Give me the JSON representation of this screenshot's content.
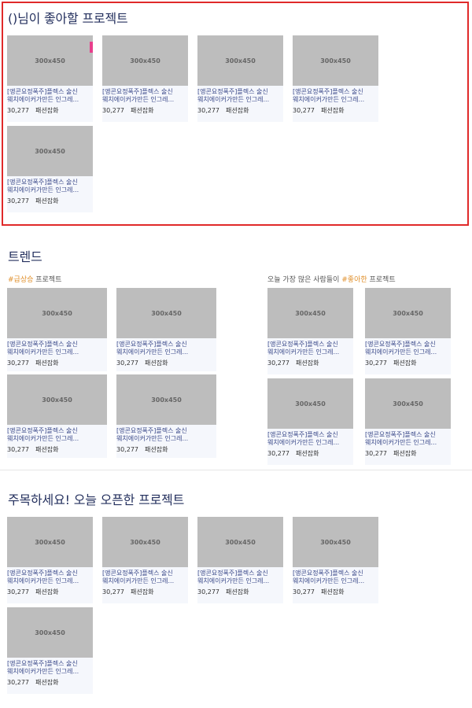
{
  "likes_section": {
    "title": "()님이 좋아할 프로젝트",
    "cards": [
      {
        "thumb": "300x450",
        "line1": "[앵콘요정폭주]플렉스 술신",
        "line2": "웨치에이커가만든 인그레...",
        "count": "30,277",
        "category": "패션잡화"
      },
      {
        "thumb": "300x450",
        "line1": "[앵콘요정폭주]플렉스 술신",
        "line2": "웨치에이커가만든 인그레...",
        "count": "30,277",
        "category": "패션잡화"
      },
      {
        "thumb": "300x450",
        "line1": "[앵콘요정폭주]플렉스 술신",
        "line2": "웨치에이커가만든 인그레...",
        "count": "30,277",
        "category": "패션잡화"
      },
      {
        "thumb": "300x450",
        "line1": "[앵콘요정폭주]플렉스 술신",
        "line2": "웨치에이커가만든 인그레...",
        "count": "30,277",
        "category": "패션잡화"
      },
      {
        "thumb": "300x450",
        "line1": "[앵콘요정폭주]플렉스 술신",
        "line2": "웨치에이커가만든 인그레...",
        "count": "30,277",
        "category": "패션잡화"
      }
    ]
  },
  "trend_section": {
    "title": "트렌드",
    "rising": {
      "prefix": "#급상승",
      "suffix": " 프로젝트",
      "cards": [
        {
          "thumb": "300x450",
          "line1": "[앵콘요정폭주]플렉스 술신",
          "line2": "웨치에이커가만든 인그레...",
          "count": "30,277",
          "category": "패션잡화"
        },
        {
          "thumb": "300x450",
          "line1": "[앵콘요정폭주]플렉스 술신",
          "line2": "웨치에이커가만든 인그레...",
          "count": "30,277",
          "category": "패션잡화"
        },
        {
          "thumb": "300x450",
          "line1": "[앵콘요정폭주]플렉스 술신",
          "line2": "웨치에이커가만든 인그레...",
          "count": "30,277",
          "category": "패션잡화"
        },
        {
          "thumb": "300x450",
          "line1": "[앵콘요정폭주]플렉스 술신",
          "line2": "웨치에이커가만든 인그레...",
          "count": "30,277",
          "category": "패션잡화"
        }
      ]
    },
    "liked": {
      "prefix": "오늘 가장 많은 사람들이 ",
      "highlight": "#좋아한",
      "suffix": " 프로젝트",
      "cards": [
        {
          "thumb": "300x450",
          "line1": "[앵콘요정폭주]플렉스 술신",
          "line2": "웨치에이커가만든 인그레...",
          "count": "30,277",
          "category": "패션잡화"
        },
        {
          "thumb": "300x450",
          "line1": "[앵콘요정폭주]플렉스 술신",
          "line2": "웨치에이커가만든 인그레...",
          "count": "30,277",
          "category": "패션잡화"
        },
        {
          "thumb": "300x450",
          "line1": "[앵콘요정폭주]플렉스 술신",
          "line2": "웨치에이커가만든 인그레...",
          "count": "30,277",
          "category": "패션잡화"
        },
        {
          "thumb": "300x450",
          "line1": "[앵콘요정폭주]플렉스 술신",
          "line2": "웨치에이커가만든 인그레...",
          "count": "30,277",
          "category": "패션잡화"
        }
      ]
    }
  },
  "today_section": {
    "title": "주목하세요! 오늘 오픈한 프로젝트",
    "cards": [
      {
        "thumb": "300x450",
        "line1": "[앵콘요정폭주]플렉스 술신",
        "line2": "웨치에이커가만든 인그레...",
        "count": "30,277",
        "category": "패션잡화"
      },
      {
        "thumb": "300x450",
        "line1": "[앵콘요정폭주]플렉스 술신",
        "line2": "웨치에이커가만든 인그레...",
        "count": "30,277",
        "category": "패션잡화"
      },
      {
        "thumb": "300x450",
        "line1": "[앵콘요정폭주]플렉스 술신",
        "line2": "웨치에이커가만든 인그레...",
        "count": "30,277",
        "category": "패션잡화"
      },
      {
        "thumb": "300x450",
        "line1": "[앵콘요정폭주]플렉스 술신",
        "line2": "웨치에이커가만든 인그레...",
        "count": "30,277",
        "category": "패션잡화"
      },
      {
        "thumb": "300x450",
        "line1": "[앵콘요정폭주]플렉스 술신",
        "line2": "웨치에이커가만든 인그레...",
        "count": "30,277",
        "category": "패션잡화"
      }
    ]
  }
}
